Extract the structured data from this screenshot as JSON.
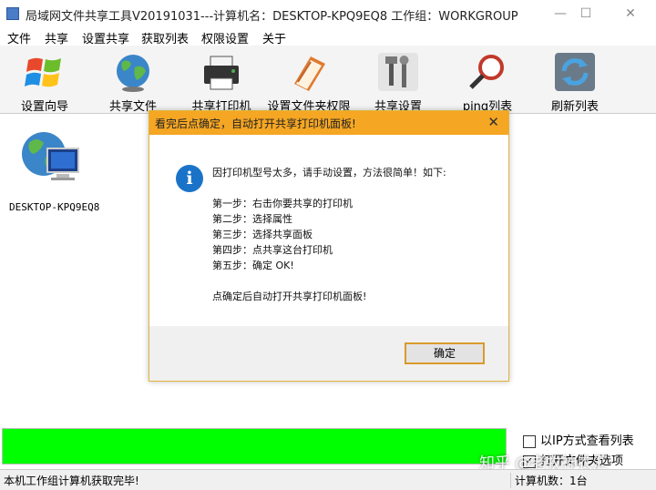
{
  "window": {
    "title": "局域网文件共享工具V20191031---计算机名：DESKTOP-KPQ9EQ8  工作组：WORKGROUP",
    "minimize": "—",
    "maximize": "☐",
    "close": "✕"
  },
  "menu": [
    "文件",
    "共享",
    "设置共享",
    "获取列表",
    "权限设置",
    "关于"
  ],
  "toolbar": [
    {
      "label": "设置向导",
      "icon": "windows-logo-icon"
    },
    {
      "label": "共享文件",
      "icon": "globe-icon"
    },
    {
      "label": "共享打印机",
      "icon": "printer-icon"
    },
    {
      "label": "设置文件夹权限",
      "icon": "folder-book-icon"
    },
    {
      "label": "共享设置",
      "icon": "tools-icon"
    },
    {
      "label": "ping列表",
      "icon": "magnifier-icon"
    },
    {
      "label": "刷新列表",
      "icon": "refresh-icon"
    }
  ],
  "computers": [
    {
      "name": "DESKTOP-KPQ9EQ8"
    }
  ],
  "dialog": {
    "title": "看完后点确定，自动打开共享打印机面板!",
    "close": "✕",
    "info_glyph": "i",
    "lines": [
      "因打印机型号太多，请手动设置，方法很简单！如下:",
      "第一步：右击你要共享的打印机",
      "第二步：选择属性",
      "第三步：选择共享面板",
      "第四步：点共享这台打印机",
      "第五步：确定  OK!",
      "点确定后自动打开共享打印机面板!"
    ],
    "ok_label": "确定"
  },
  "progress": {
    "fill_fraction": 1.0,
    "color": "#00ff00"
  },
  "options": {
    "ip_view": {
      "label": "以IP方式查看列表",
      "checked": false
    },
    "second": {
      "label": "打开文件夹选项",
      "checked": true
    }
  },
  "status": {
    "left": "本机工作组计算机获取完毕!",
    "right": "计算机数：1台"
  },
  "watermark": "知乎 @老牧神农汇"
}
